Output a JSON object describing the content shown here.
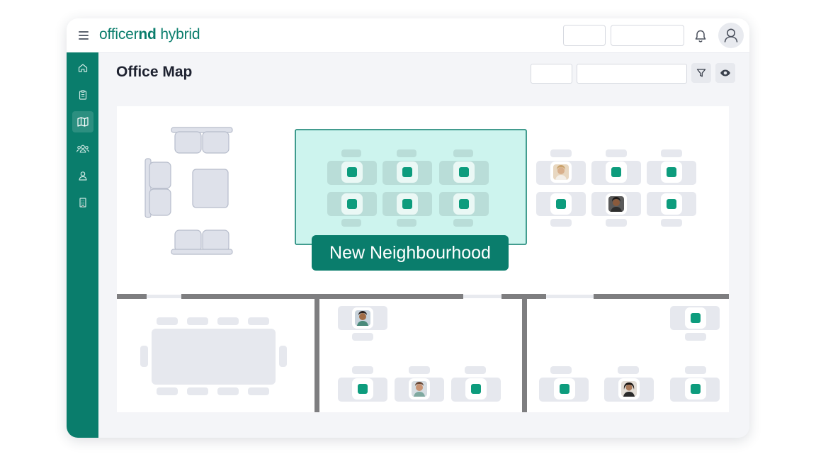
{
  "app": {
    "logo_regular": "officer",
    "logo_bold": "nd",
    "logo_suffix": " hybrid"
  },
  "colors": {
    "brand": "#0a7d6c",
    "neighbourhood_fill": "#cdf4ee",
    "desk_available": "#0d9c7d",
    "wall": "#7e7e80",
    "furniture": "#dee1ea"
  },
  "icons": {
    "menu": "hamburger-icon",
    "notifications": "bell-icon",
    "profile": "user-avatar-icon",
    "filter": "filter-icon",
    "visibility": "eye-icon",
    "sidebar": [
      "home-icon",
      "clipboard-icon",
      "map-icon",
      "people-icon",
      "person-icon",
      "building-icon"
    ]
  },
  "sidebar": {
    "active_item": "map-icon"
  },
  "page": {
    "title": "Office Map"
  },
  "map": {
    "neighbourhood_label": "New Neighbourhood"
  }
}
